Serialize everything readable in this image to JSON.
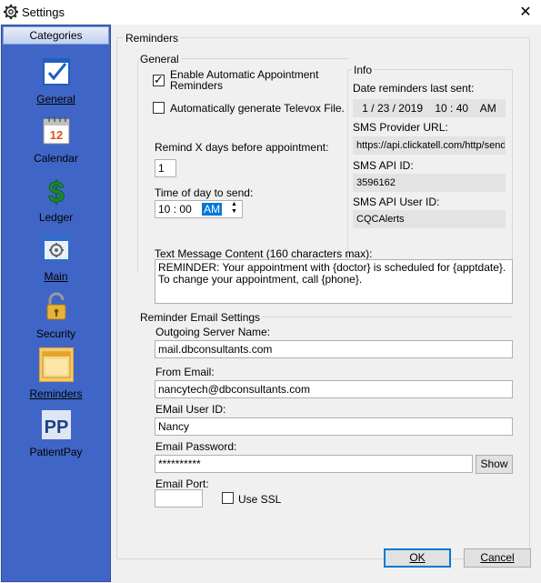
{
  "window": {
    "title": "Settings",
    "gear_icon": "gear-icon",
    "close_glyph": "✕"
  },
  "sidebar": {
    "header": "Categories",
    "items": [
      {
        "label": "General",
        "icon": "checklist-icon"
      },
      {
        "label": "Calendar",
        "icon": "calendar-icon",
        "calendar_number": "12"
      },
      {
        "label": "Ledger",
        "icon": "dollar-icon",
        "glyph": "$"
      },
      {
        "label": "Main",
        "icon": "window-gear-icon"
      },
      {
        "label": "Security",
        "icon": "padlock-icon"
      },
      {
        "label": "Reminders",
        "icon": "note-icon",
        "selected": true
      },
      {
        "label": "PatientPay",
        "icon": "patientpay-logo-icon",
        "logo_text": "PP"
      }
    ]
  },
  "reminders": {
    "group_title": "Reminders",
    "general": {
      "group_title": "General",
      "auto_reminders_label": "Enable Automatic Appointment Reminders",
      "auto_reminders_checked": true,
      "televox_label": "Automatically generate Televox File.",
      "televox_checked": false,
      "remind_days_label": "Remind X days before appointment:",
      "remind_days_value": "1",
      "time_label": "Time of day to send:",
      "time_hour": "10",
      "time_sep": ":",
      "time_minute": "00",
      "time_ampm": "AM",
      "spin_up": "▲",
      "spin_down": "▼"
    },
    "info": {
      "group_title": "Info",
      "last_sent_label": "Date reminders last sent:",
      "last_sent_value": "1 / 23 / 2019    10 : 40    AM",
      "sms_url_label": "SMS Provider URL:",
      "sms_url_value": "https://api.clickatell.com/http/send",
      "sms_api_id_label": "SMS API ID:",
      "sms_api_id_value": "3596162",
      "sms_user_label": "SMS API User ID:",
      "sms_user_value": "CQCAlerts"
    },
    "message": {
      "label": "Text Message Content (160 characters max):",
      "value": "REMINDER: Your appointment with {doctor} is scheduled for {apptdate}.  To change your appointment, call {phone}."
    },
    "email": {
      "group_title": "Reminder Email Settings",
      "server_label": "Outgoing Server Name:",
      "server_value": "mail.dbconsultants.com",
      "from_label": "From Email:",
      "from_value": "nancytech@dbconsultants.com",
      "user_label": "EMail User ID:",
      "user_value": "Nancy",
      "password_label": "Email Password:",
      "password_value": "**********",
      "show_label": "Show",
      "port_label": "Email Port:",
      "port_value": "",
      "ssl_label": "Use SSL",
      "ssl_checked": false
    }
  },
  "footer": {
    "ok_label": "OK",
    "cancel_label": "Cancel"
  }
}
